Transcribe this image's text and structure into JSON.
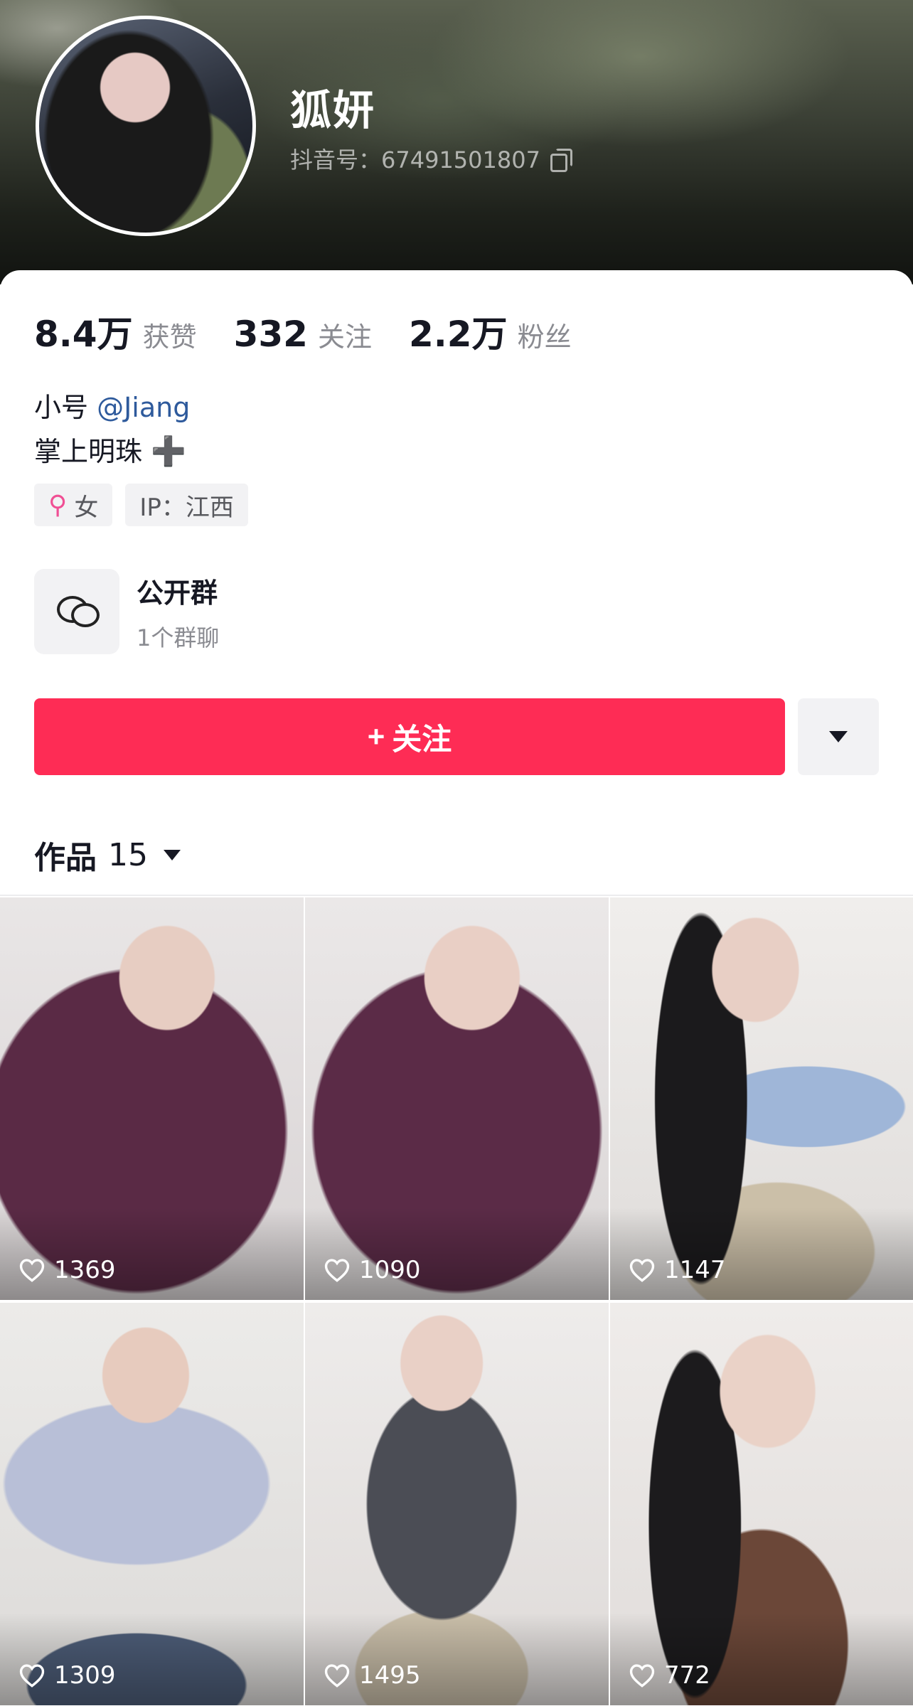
{
  "profile": {
    "name": "狐妍",
    "douyin_id": "抖音号：67491501807"
  },
  "stats": [
    {
      "value": "8.4万",
      "label": "获赞"
    },
    {
      "value": "332",
      "label": "关注"
    },
    {
      "value": "2.2万",
      "label": "粉丝"
    }
  ],
  "bio": {
    "line1_prefix": "小号 ",
    "line1_mention": "@Jiang",
    "line2": "掌上明珠",
    "line2_emoji": "➕"
  },
  "tags": {
    "gender_icon": "⚲",
    "gender": "女",
    "ip": "IP：江西"
  },
  "group": {
    "title": "公开群",
    "subtitle": "1个群聊"
  },
  "follow_button": {
    "icon": "+",
    "label": "关注"
  },
  "works": {
    "label": "作品",
    "count": "15"
  },
  "videos": [
    {
      "likes": "1369"
    },
    {
      "likes": "1090"
    },
    {
      "likes": "1147"
    },
    {
      "likes": "1309"
    },
    {
      "likes": "1495"
    },
    {
      "likes": "772"
    }
  ],
  "colors": {
    "accent": "#fe2c55",
    "mention": "#2e5a9c",
    "female_icon": "#f04f94"
  }
}
